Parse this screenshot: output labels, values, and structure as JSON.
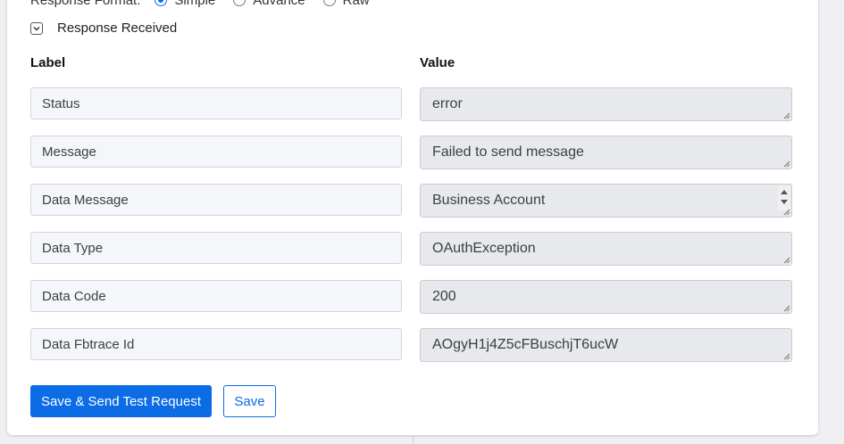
{
  "response_format": {
    "label": "Response Format:",
    "options": [
      {
        "label": "Simple",
        "selected": true
      },
      {
        "label": "Advance",
        "selected": false
      },
      {
        "label": "Raw",
        "selected": false
      }
    ]
  },
  "response_received": {
    "label": "Response Received",
    "icon": "chevron-down-icon",
    "expanded": true
  },
  "columns": {
    "label": "Label",
    "value": "Value"
  },
  "rows": [
    {
      "label": "Status",
      "value": "error"
    },
    {
      "label": "Message",
      "value": "Failed to send message"
    },
    {
      "label": "Data Message",
      "value": "Business Account"
    },
    {
      "label": "Data Type",
      "value": "OAuthException"
    },
    {
      "label": "Data Code",
      "value": "200"
    },
    {
      "label": "Data Fbtrace Id",
      "value": "AOgyH1j4Z5cFBuschjT6ucW"
    }
  ],
  "buttons": {
    "save_send": "Save & Send Test Request",
    "save": "Save"
  },
  "colors": {
    "accent": "#0b6ce6",
    "label_bg": "#f4f6f9",
    "value_bg": "#e7e9ec"
  }
}
